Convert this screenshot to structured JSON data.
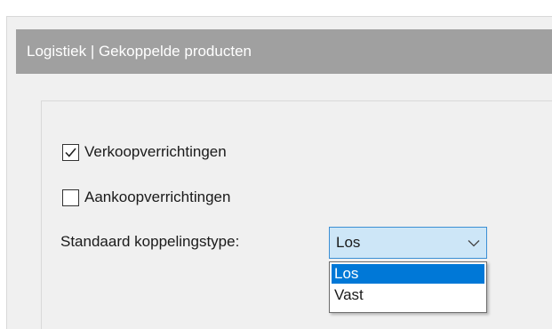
{
  "section": {
    "title": "Logistiek | Gekoppelde producten"
  },
  "options": {
    "sales": {
      "label": "Verkoopverrichtingen",
      "checked": true
    },
    "purchase": {
      "label": "Aankoopverrichtingen",
      "checked": false
    }
  },
  "link_type": {
    "label": "Standaard koppelingstype:",
    "selected": "Los",
    "options": [
      "Los",
      "Vast"
    ]
  },
  "colors": {
    "header_bg": "#a0a0a0",
    "combo_bg": "#cde6f7",
    "combo_border": "#3b8fd4",
    "selection": "#0078d7"
  },
  "icons": {
    "checkmark": "check-icon",
    "dropdown": "chevron-down-icon"
  }
}
